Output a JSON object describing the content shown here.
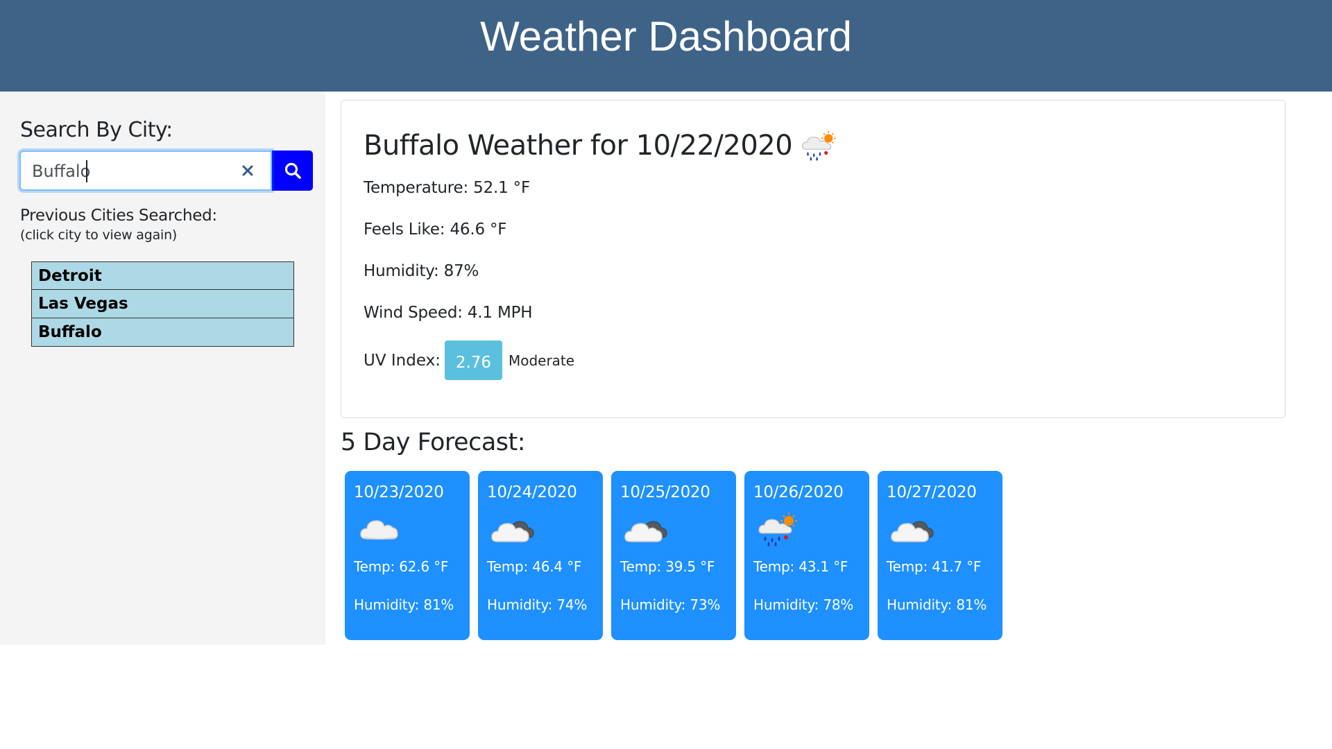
{
  "header": {
    "title": "Weather Dashboard"
  },
  "colors": {
    "header_bg": "#3f6387",
    "search_button": "#0000ff",
    "city_item_bg": "#add8e6",
    "forecast_card": "#1e90ff",
    "uv_badge": "#5bc0de"
  },
  "sidebar": {
    "search_label": "Search By City:",
    "search_value": "Buffalo",
    "clear_icon": "close-icon",
    "search_icon": "search-icon",
    "previous_label": "Previous Cities Searched:",
    "previous_hint": "(click city to view again)",
    "cities": [
      "Detroit",
      "Las Vegas",
      "Buffalo"
    ]
  },
  "current": {
    "title": "Buffalo Weather for 10/22/2020",
    "icon": "rain-sun-icon",
    "temperature": "Temperature: 52.1 °F",
    "feels_like": "Feels Like: 46.6 °F",
    "humidity": "Humidity: 87%",
    "wind": "Wind Speed: 4.1 MPH",
    "uv_label": "UV Index:",
    "uv_value": "2.76",
    "uv_text": "Moderate"
  },
  "forecast": {
    "title": "5 Day Forecast:",
    "days": [
      {
        "date": "10/23/2020",
        "icon": "cloud-icon",
        "temp": "Temp: 62.6 °F",
        "humidity": "Humidity: 81%"
      },
      {
        "date": "10/24/2020",
        "icon": "overcast-icon",
        "temp": "Temp: 46.4 °F",
        "humidity": "Humidity: 74%"
      },
      {
        "date": "10/25/2020",
        "icon": "overcast-icon",
        "temp": "Temp: 39.5 °F",
        "humidity": "Humidity: 73%"
      },
      {
        "date": "10/26/2020",
        "icon": "rain-sun-icon",
        "temp": "Temp: 43.1 °F",
        "humidity": "Humidity: 78%"
      },
      {
        "date": "10/27/2020",
        "icon": "overcast-icon",
        "temp": "Temp: 41.7 °F",
        "humidity": "Humidity: 81%"
      }
    ]
  }
}
